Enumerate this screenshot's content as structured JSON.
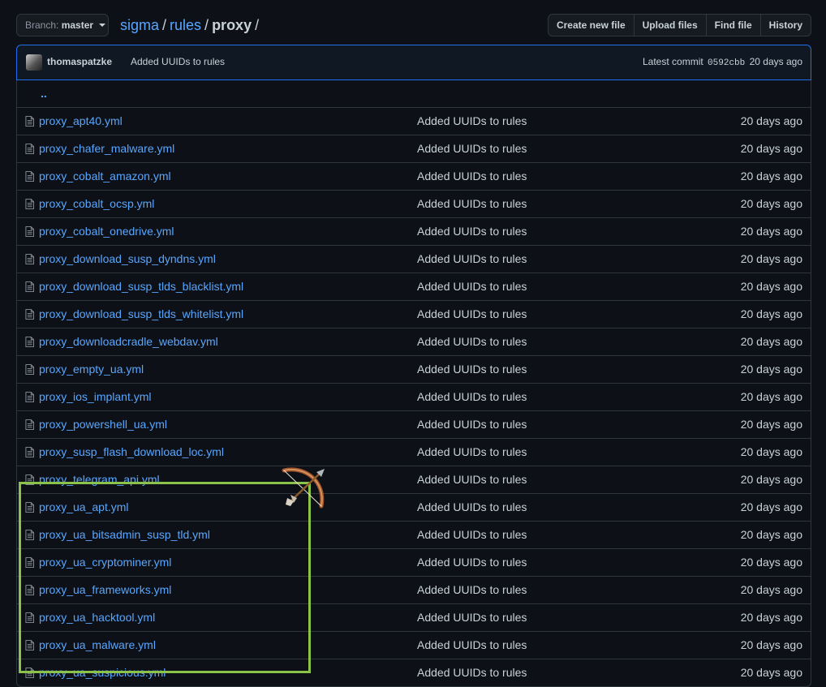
{
  "branch": {
    "prefix": "Branch:",
    "name": "master"
  },
  "breadcrumb": {
    "repo": "sigma",
    "folder": "rules",
    "current": "proxy",
    "sep": "/"
  },
  "toolbar": [
    "Create new file",
    "Upload files",
    "Find file",
    "History"
  ],
  "commit": {
    "author": "thomaspatzke",
    "message": "Added UUIDs to rules",
    "latest_label": "Latest commit",
    "sha": "0592cbb",
    "age": "20 days ago"
  },
  "parent_dir": "..",
  "files": [
    {
      "name": "proxy_apt40.yml",
      "message": "Added UUIDs to rules",
      "age": "20 days ago"
    },
    {
      "name": "proxy_chafer_malware.yml",
      "message": "Added UUIDs to rules",
      "age": "20 days ago"
    },
    {
      "name": "proxy_cobalt_amazon.yml",
      "message": "Added UUIDs to rules",
      "age": "20 days ago"
    },
    {
      "name": "proxy_cobalt_ocsp.yml",
      "message": "Added UUIDs to rules",
      "age": "20 days ago"
    },
    {
      "name": "proxy_cobalt_onedrive.yml",
      "message": "Added UUIDs to rules",
      "age": "20 days ago"
    },
    {
      "name": "proxy_download_susp_dyndns.yml",
      "message": "Added UUIDs to rules",
      "age": "20 days ago"
    },
    {
      "name": "proxy_download_susp_tlds_blacklist.yml",
      "message": "Added UUIDs to rules",
      "age": "20 days ago"
    },
    {
      "name": "proxy_download_susp_tlds_whitelist.yml",
      "message": "Added UUIDs to rules",
      "age": "20 days ago"
    },
    {
      "name": "proxy_downloadcradle_webdav.yml",
      "message": "Added UUIDs to rules",
      "age": "20 days ago"
    },
    {
      "name": "proxy_empty_ua.yml",
      "message": "Added UUIDs to rules",
      "age": "20 days ago"
    },
    {
      "name": "proxy_ios_implant.yml",
      "message": "Added UUIDs to rules",
      "age": "20 days ago"
    },
    {
      "name": "proxy_powershell_ua.yml",
      "message": "Added UUIDs to rules",
      "age": "20 days ago"
    },
    {
      "name": "proxy_susp_flash_download_loc.yml",
      "message": "Added UUIDs to rules",
      "age": "20 days ago"
    },
    {
      "name": "proxy_telegram_api.yml",
      "message": "Added UUIDs to rules",
      "age": "20 days ago"
    },
    {
      "name": "proxy_ua_apt.yml",
      "message": "Added UUIDs to rules",
      "age": "20 days ago"
    },
    {
      "name": "proxy_ua_bitsadmin_susp_tld.yml",
      "message": "Added UUIDs to rules",
      "age": "20 days ago"
    },
    {
      "name": "proxy_ua_cryptominer.yml",
      "message": "Added UUIDs to rules",
      "age": "20 days ago"
    },
    {
      "name": "proxy_ua_frameworks.yml",
      "message": "Added UUIDs to rules",
      "age": "20 days ago"
    },
    {
      "name": "proxy_ua_hacktool.yml",
      "message": "Added UUIDs to rules",
      "age": "20 days ago"
    },
    {
      "name": "proxy_ua_malware.yml",
      "message": "Added UUIDs to rules",
      "age": "20 days ago"
    },
    {
      "name": "proxy_ua_suspicious.yml",
      "message": "Added UUIDs to rules",
      "age": "20 days ago"
    }
  ],
  "colors": {
    "link": "#58a6ff",
    "highlight": "#8bc34a",
    "background": "#0d1117"
  },
  "icons": {
    "file": "file-text-icon",
    "annotation": "bow-and-arrow-icon"
  }
}
